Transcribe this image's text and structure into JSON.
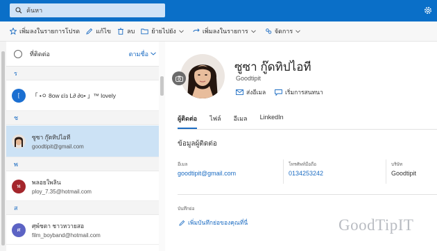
{
  "search": {
    "placeholder": "ค้นหา"
  },
  "toolbar": {
    "items": [
      {
        "label": "เพิ่มลงในรายการโปรด",
        "icon": "star-icon"
      },
      {
        "label": "แก้ไข",
        "icon": "pencil-icon"
      },
      {
        "label": "ลบ",
        "icon": "trash-icon"
      },
      {
        "label": "ย้ายไปยัง",
        "icon": "folder-move-icon"
      },
      {
        "label": "เพิ่มลงในรายการ",
        "icon": "add-to-list-icon"
      },
      {
        "label": "จัดการ",
        "icon": "manage-icon"
      }
    ]
  },
  "list": {
    "header_title": "ที่ติดต่อ",
    "sort_label": "ตามชื่อ",
    "groups": [
      {
        "letter": "ร"
      },
      {
        "letter": "ช"
      },
      {
        "letter": "พ"
      },
      {
        "letter": "ส"
      }
    ],
    "contacts": [
      {
        "name": "「 •ㅇ 8ow εïɜ L∂ ∂o• 」™ lovely",
        "email": "",
        "initial": "[",
        "color": "#1b6fd1"
      },
      {
        "name": "ซูซา กู๊ดทิปไอที",
        "email": "goodtipit@gmail.com",
        "initial": "",
        "color": "#a36b4e"
      },
      {
        "name": "พลอยใพลิน",
        "email": "ploy_7.35@hotmail.com",
        "initial": "พ",
        "color": "#a4262c"
      },
      {
        "name": "ศุพ์ชตา ชาวหวายสอ",
        "email": "film_boyband@hotmail.com",
        "initial": "ศ",
        "color": "#5c63c4"
      }
    ]
  },
  "profile": {
    "name": "ซูซา กู๊ดทิปไอที",
    "subtitle": "Goodtipit",
    "send_email": "ส่งอีเมล",
    "start_chat": "เริ่มการสนทนา",
    "tabs": [
      "ผู้ติดต่อ",
      "ไฟล์",
      "อีเมล",
      "LinkedIn"
    ],
    "section_title": "ข้อมูลผู้ติดต่อ",
    "fields": [
      {
        "label": "อีเมล",
        "value": "goodtipit@gmail.com",
        "link": true
      },
      {
        "label": "โทรศัพท์มือถือ",
        "value": "0134253242",
        "link": true
      },
      {
        "label": "บริษัท",
        "value": "Goodtipit",
        "link": false
      }
    ],
    "notes_label": "บันทึกย่อ",
    "add_note": "เพิ่มบันทึกย่อของคุณที่นี่"
  },
  "watermark": "GoodTipIT",
  "colors": {
    "accent": "#1a6bc2",
    "topbar": "#0a6fc8",
    "selected": "#cce2f5"
  }
}
